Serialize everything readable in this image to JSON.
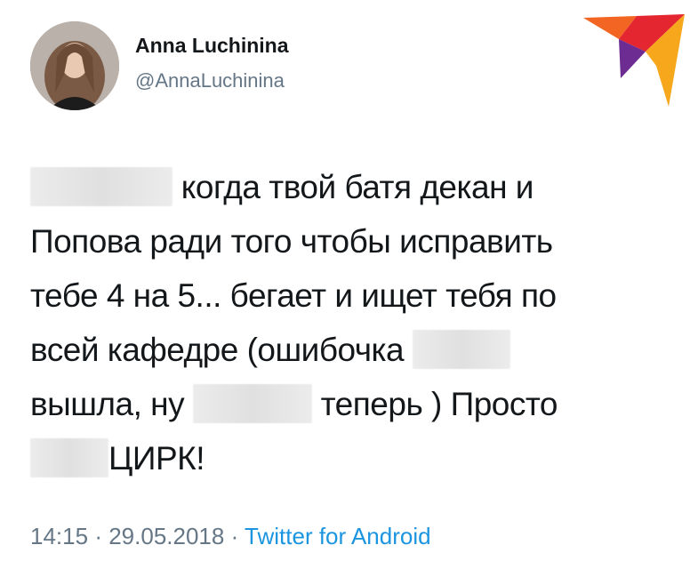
{
  "user": {
    "display_name": "Anna Luchinina",
    "handle": "@AnnaLuchinina"
  },
  "tweet": {
    "lines": [
      {
        "before": "",
        "after": "когда твой батя декан и"
      },
      {
        "text": "Попова ради того чтобы исправить"
      },
      {
        "text": "тебе 4 на 5... бегает и ищет тебя по"
      },
      {
        "before": "всей кафедре (ошибочка",
        "after": ""
      },
      {
        "before": "вышла, ну",
        "after": "теперь ) Просто"
      },
      {
        "before": "",
        "after": "ЦИРК!"
      }
    ]
  },
  "meta": {
    "time": "14:15",
    "separator": "·",
    "date": "29.05.2018",
    "source": "Twitter for Android"
  },
  "icons": {
    "logo": "bird-logo-icon",
    "avatar": "user-avatar"
  },
  "colors": {
    "handle": "#657786",
    "source_link": "#1b95e0",
    "logo_orange": "#f26522",
    "logo_red": "#e3262f",
    "logo_purple": "#6d2c91",
    "logo_yellow": "#f7a71c"
  }
}
